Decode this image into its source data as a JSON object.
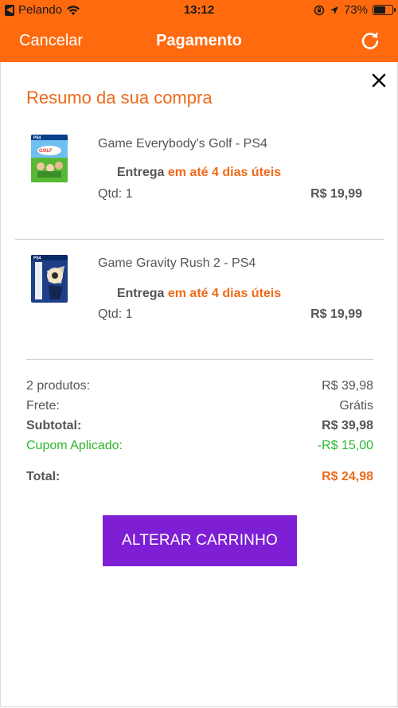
{
  "status_bar": {
    "carrier": "Pelando",
    "time": "13:12",
    "battery": "73%",
    "battery_level": 0.73,
    "icons": [
      "back-arrow-icon",
      "wifi-icon",
      "orientation-lock-icon",
      "location-icon",
      "battery-icon"
    ]
  },
  "navbar": {
    "cancel_label": "Cancelar",
    "title": "Pagamento",
    "refresh_icon": "refresh-icon",
    "background_color": "#ff6a0e"
  },
  "summary": {
    "title": "Resumo da sua compra",
    "close_icon": "close-icon",
    "items": [
      {
        "name": "Game Everybody's Golf - PS4",
        "delivery_prefix": "Entrega",
        "delivery_highlight": "em até 4 dias úteis",
        "qty": "Qtd: 1",
        "price": "R$ 19,99"
      },
      {
        "name": "Game Gravity Rush 2 - PS4",
        "delivery_prefix": "Entrega",
        "delivery_highlight": "em até 4 dias úteis",
        "qty": "Qtd: 1",
        "price": "R$ 19,99"
      }
    ],
    "totals": {
      "products_label": "2 produtos:",
      "products_value": "R$ 39,98",
      "shipping_label": "Frete:",
      "shipping_value": "Grátis",
      "subtotal_label": "Subtotal:",
      "subtotal_value": "R$ 39,98",
      "coupon_label": "Cupom Aplicado:",
      "coupon_value": "-R$ 15,00",
      "total_label": "Total:",
      "total_value": "R$ 24,98"
    },
    "alter_cart_label": "ALTERAR CARRINHO"
  },
  "colors": {
    "accent_orange": "#ef6a1b",
    "coupon_green": "#2fb52f",
    "button_purple": "#7e1fd6"
  }
}
